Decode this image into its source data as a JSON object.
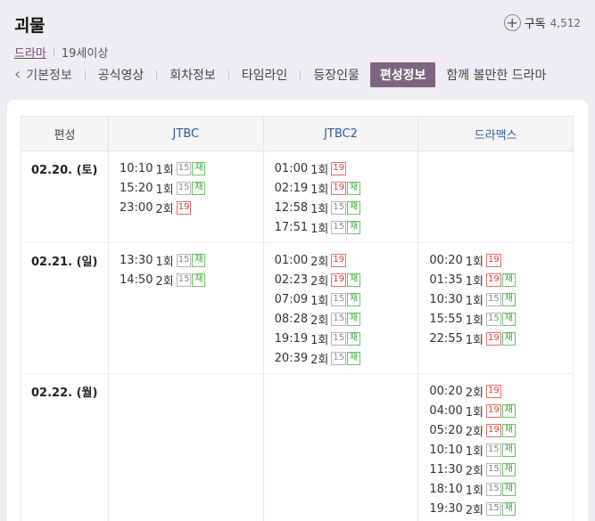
{
  "header": {
    "title": "괴물",
    "genre": "드라마",
    "rating": "19세이상",
    "subscribe_label": "구독",
    "subscribe_count": "4,512",
    "plus_glyph": "+"
  },
  "tabs": {
    "prev_arrow": "‹",
    "items": [
      {
        "label": "기본정보",
        "active": false
      },
      {
        "label": "공식영상",
        "active": false
      },
      {
        "label": "회차정보",
        "active": false
      },
      {
        "label": "타임라인",
        "active": false
      },
      {
        "label": "등장인물",
        "active": false
      },
      {
        "label": "편성정보",
        "active": true
      },
      {
        "label": "함께 볼만한 드라마",
        "active": false
      }
    ]
  },
  "schedule": {
    "header_label": "편성",
    "channels": [
      "JTBC",
      "JTBC2",
      "드라맥스"
    ],
    "badge_labels": {
      "re": "재"
    },
    "rows": [
      {
        "date": "02.20. (토)",
        "cells": [
          [
            {
              "time": "10:10",
              "ep": "1회",
              "age": "15",
              "re": true
            },
            {
              "time": "15:20",
              "ep": "1회",
              "age": "15",
              "re": true
            },
            {
              "time": "23:00",
              "ep": "2회",
              "age": "19",
              "re": false
            }
          ],
          [
            {
              "time": "01:00",
              "ep": "1회",
              "age": "19",
              "re": false
            },
            {
              "time": "02:19",
              "ep": "1회",
              "age": "19",
              "re": true
            },
            {
              "time": "12:58",
              "ep": "1회",
              "age": "15",
              "re": true
            },
            {
              "time": "17:51",
              "ep": "1회",
              "age": "15",
              "re": true
            }
          ],
          []
        ]
      },
      {
        "date": "02.21. (일)",
        "cells": [
          [
            {
              "time": "13:30",
              "ep": "1회",
              "age": "15",
              "re": true
            },
            {
              "time": "14:50",
              "ep": "2회",
              "age": "15",
              "re": true
            }
          ],
          [
            {
              "time": "01:00",
              "ep": "2회",
              "age": "19",
              "re": false
            },
            {
              "time": "02:23",
              "ep": "2회",
              "age": "19",
              "re": true
            },
            {
              "time": "07:09",
              "ep": "1회",
              "age": "15",
              "re": true
            },
            {
              "time": "08:28",
              "ep": "2회",
              "age": "15",
              "re": true
            },
            {
              "time": "19:19",
              "ep": "1회",
              "age": "15",
              "re": true
            },
            {
              "time": "20:39",
              "ep": "2회",
              "age": "15",
              "re": true
            }
          ],
          [
            {
              "time": "00:20",
              "ep": "1회",
              "age": "19",
              "re": false
            },
            {
              "time": "01:35",
              "ep": "1회",
              "age": "19",
              "re": true
            },
            {
              "time": "10:30",
              "ep": "1회",
              "age": "15",
              "re": true
            },
            {
              "time": "15:55",
              "ep": "1회",
              "age": "15",
              "re": true
            },
            {
              "time": "22:55",
              "ep": "1회",
              "age": "19",
              "re": true
            }
          ]
        ]
      },
      {
        "date": "02.22. (월)",
        "cells": [
          [],
          [],
          [
            {
              "time": "00:20",
              "ep": "2회",
              "age": "19",
              "re": false
            },
            {
              "time": "04:00",
              "ep": "1회",
              "age": "19",
              "re": true
            },
            {
              "time": "05:20",
              "ep": "2회",
              "age": "19",
              "re": true
            },
            {
              "time": "10:10",
              "ep": "1회",
              "age": "15",
              "re": true
            },
            {
              "time": "11:30",
              "ep": "2회",
              "age": "15",
              "re": true
            },
            {
              "time": "18:10",
              "ep": "1회",
              "age": "15",
              "re": true
            },
            {
              "time": "19:30",
              "ep": "2회",
              "age": "15",
              "re": true
            }
          ]
        ]
      }
    ]
  },
  "colors": {
    "active_tab_bg": "#7d6580",
    "channel_text": "#2e5fa3",
    "badge_19": "#d7423c",
    "badge_re": "#38a63a"
  }
}
